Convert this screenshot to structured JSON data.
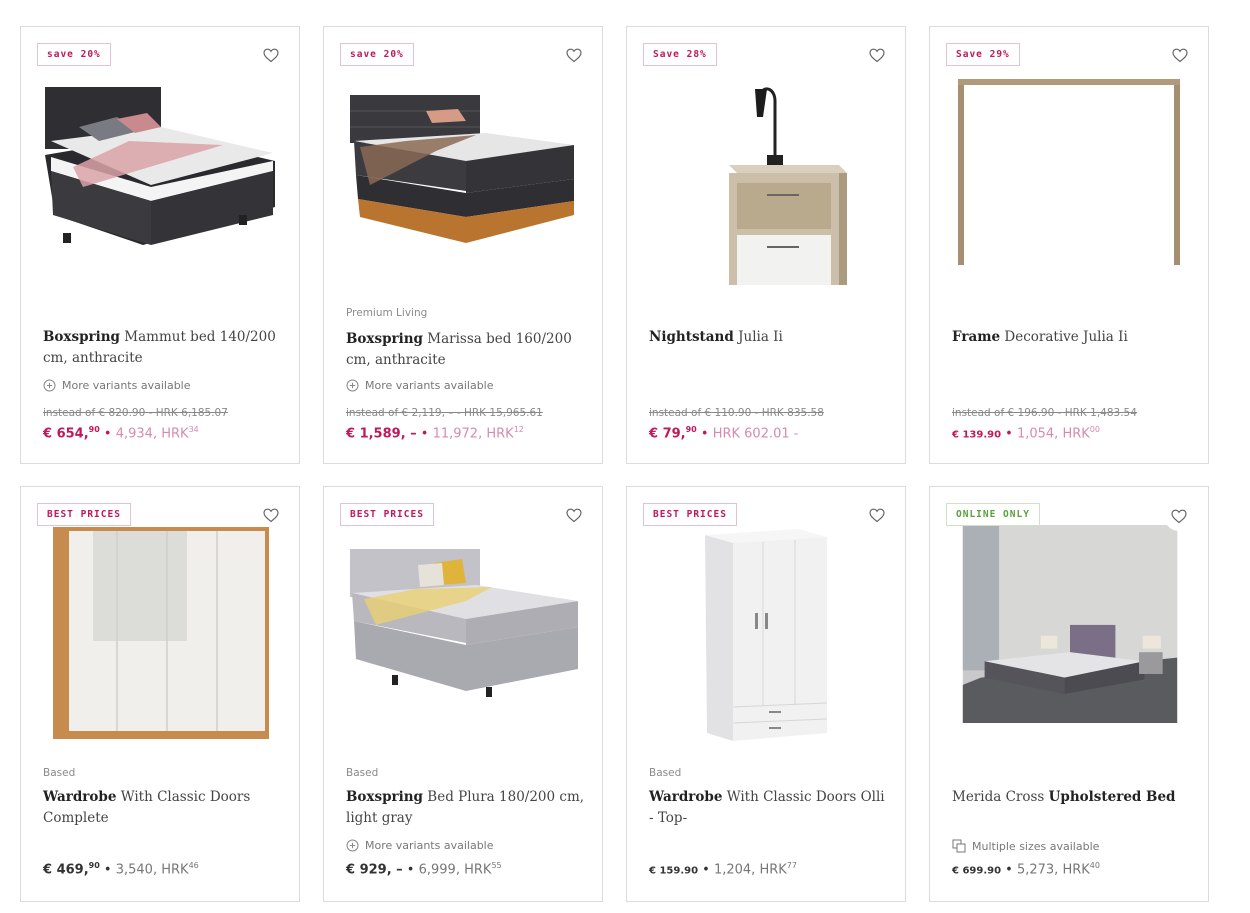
{
  "products": [
    {
      "badge": "save 20%",
      "brand": "",
      "title_bold": "Boxspring",
      "title_rest": " Mammut bed 140/200 cm, anthracite",
      "variants": "More variants available",
      "old_price": "instead of € 820.90 - HRK 6,185.07",
      "price_main": "€ 654,",
      "price_cents": "90",
      "price_sep": " • ",
      "price_secondary": "4,934, HRK",
      "price_secondary_cents": "34",
      "image": "bed-anthracite"
    },
    {
      "badge": "save 20%",
      "brand": "Premium Living",
      "title_bold": "Boxspring",
      "title_rest": " Marissa bed 160/200 cm, anthracite",
      "variants": "More variants available",
      "old_price": "instead of € 2,119, – - HRK 15,965.61",
      "price_main": "€ 1,589, –",
      "price_cents": "",
      "price_sep": " • ",
      "price_secondary": "11,972, HRK",
      "price_secondary_cents": "12",
      "image": "bed-wood-base"
    },
    {
      "badge": "Save 28%",
      "brand": "",
      "title_bold": "Nightstand",
      "title_rest": " Julia Ii",
      "variants": "",
      "old_price": "instead of € 110.90 - HRK 835.58",
      "price_main": "€ 79,",
      "price_cents": "90",
      "price_sep": " • ",
      "price_secondary": "HRK 602.01 -",
      "price_secondary_cents": "",
      "image": "nightstand"
    },
    {
      "badge": "Save 29%",
      "brand": "",
      "title_bold": "Frame",
      "title_rest": " Decorative Julia Ii",
      "variants": "",
      "old_price": "instead of € 196.90 - HRK 1,483.54",
      "price_main": "€ 139.90",
      "price_cents": "",
      "price_sep": " • ",
      "price_secondary": "1,054, HRK",
      "price_secondary_cents": "00",
      "image": "frame"
    },
    {
      "badge": "BEST PRICES",
      "brand": "Based",
      "title_bold": "Wardrobe",
      "title_rest": " With Classic Doors Complete",
      "variants": "",
      "old_price": "",
      "price_main": "€ 469,",
      "price_cents": "90",
      "price_sep": " • ",
      "price_secondary": "3,540, HRK",
      "price_secondary_cents": "46",
      "image": "wardrobe-oak"
    },
    {
      "badge": "BEST PRICES",
      "brand": "Based",
      "title_bold": "Boxspring",
      "title_rest": " Bed Plura 180/200 cm, light gray",
      "variants": "More variants available",
      "old_price": "",
      "price_main": "€ 929, –",
      "price_cents": "",
      "price_sep": " • ",
      "price_secondary": "6,999, HRK",
      "price_secondary_cents": "55",
      "image": "bed-grey"
    },
    {
      "badge": "BEST PRICES",
      "brand": "Based",
      "title_bold": "Wardrobe",
      "title_rest": " With Classic Doors Olli - Top-",
      "variants": "",
      "old_price": "",
      "price_main": "€ 159.90",
      "price_cents": "",
      "price_sep": " • ",
      "price_secondary": "1,204, HRK",
      "price_secondary_cents": "77",
      "image": "wardrobe-white"
    },
    {
      "badge": "ONLINE ONLY",
      "brand": "",
      "title_plain": "Merida Cross ",
      "title_bold": "Upholstered Bed",
      "title_rest": "",
      "variants": "Multiple sizes available",
      "old_price": "",
      "price_main": "€ 699.90",
      "price_cents": "",
      "price_sep": " • ",
      "price_secondary": "5,273, HRK",
      "price_secondary_cents": "40",
      "image": "bedroom-photo"
    }
  ],
  "icons": {
    "heart": "heart-outline-icon",
    "plus": "plus-circle-icon",
    "sizes": "multiple-sizes-icon"
  },
  "colors": {
    "accent": "#c2185b",
    "online": "#5aa03c"
  }
}
